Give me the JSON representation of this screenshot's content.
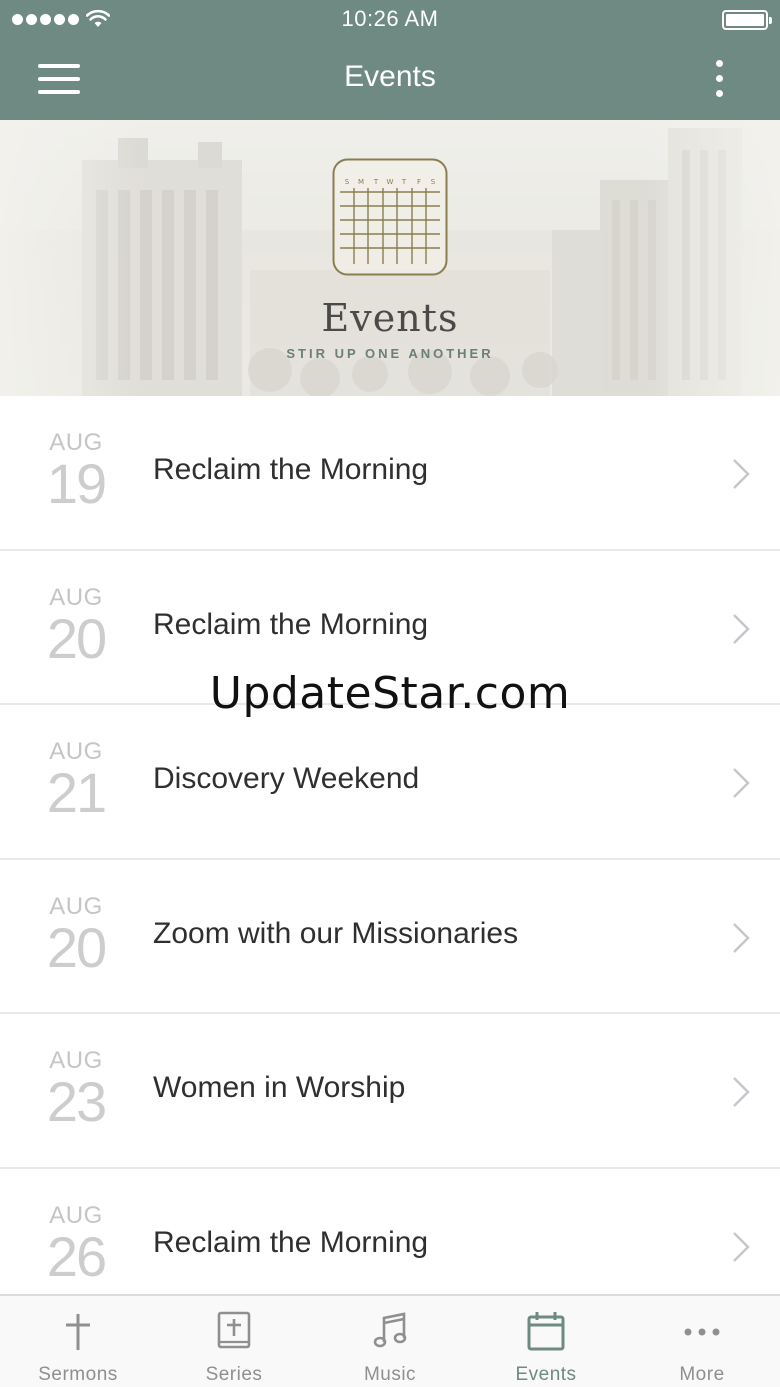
{
  "status_bar": {
    "time": "10:26 AM"
  },
  "nav": {
    "title": "Events"
  },
  "banner": {
    "title": "Events",
    "subtitle": "STIR UP ONE ANOTHER",
    "calendar_days": [
      "S",
      "M",
      "T",
      "W",
      "T",
      "F",
      "S"
    ]
  },
  "events": [
    {
      "month": "AUG",
      "day": "19",
      "title": "Reclaim the Morning"
    },
    {
      "month": "AUG",
      "day": "20",
      "title": "Reclaim the Morning"
    },
    {
      "month": "AUG",
      "day": "21",
      "title": "Discovery Weekend"
    },
    {
      "month": "AUG",
      "day": "20",
      "title": "Zoom with our Missionaries"
    },
    {
      "month": "AUG",
      "day": "23",
      "title": "Women in Worship"
    },
    {
      "month": "AUG",
      "day": "26",
      "title": "Reclaim the Morning"
    }
  ],
  "watermark": "UpdateStar.com",
  "tabs": [
    {
      "label": "Sermons",
      "icon": "cross-icon"
    },
    {
      "label": "Series",
      "icon": "bible-icon"
    },
    {
      "label": "Music",
      "icon": "music-note-icon"
    },
    {
      "label": "Events",
      "icon": "calendar-icon",
      "active": true
    },
    {
      "label": "More",
      "icon": "more-dots-icon"
    }
  ],
  "colors": {
    "accent": "#6e8a82",
    "tab_inactive": "#8f8f8f",
    "date_gray": "#c5c5c5"
  }
}
